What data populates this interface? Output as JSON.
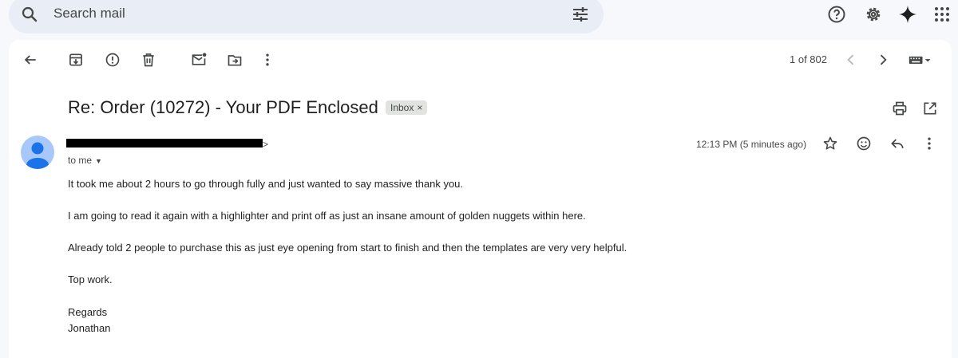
{
  "search": {
    "placeholder": "Search mail"
  },
  "pager": {
    "label": "1 of 802"
  },
  "email": {
    "subject": "Re: Order (10272) - Your PDF Enclosed",
    "label_chip": "Inbox",
    "chip_close": "×",
    "sender_tail": ">",
    "recipient": "to me",
    "timestamp": "12:13 PM (5 minutes ago)",
    "body": [
      "It took me about 2 hours to go through fully and just wanted to say massive thank you.",
      "I am going to read it again with a highlighter and print off as just an insane amount of golden nuggets within here.",
      "Already told 2 people to purchase this as just eye opening from start to finish and then the templates are very very helpful.",
      "Top work.",
      "Regards",
      "Jonathan"
    ]
  },
  "icons": {
    "top": [
      "search-icon",
      "tune-icon",
      "help-icon",
      "settings-icon",
      "gemini-icon",
      "apps-icon"
    ],
    "toolbar": [
      "back-icon",
      "archive-icon",
      "report-spam-icon",
      "delete-icon",
      "mark-unread-icon",
      "move-to-icon",
      "more-vert-icon",
      "chevron-left-icon",
      "chevron-right-icon",
      "keyboard-icon"
    ],
    "message": [
      "print-icon",
      "open-new-window-icon",
      "star-icon",
      "emoji-icon",
      "reply-icon",
      "more-vert-icon"
    ]
  },
  "colors": {
    "background": "#f6f8fc",
    "search_bg": "#e9eef6",
    "avatar": "#a8c7fa",
    "avatar_figure": "#1a73e8"
  }
}
